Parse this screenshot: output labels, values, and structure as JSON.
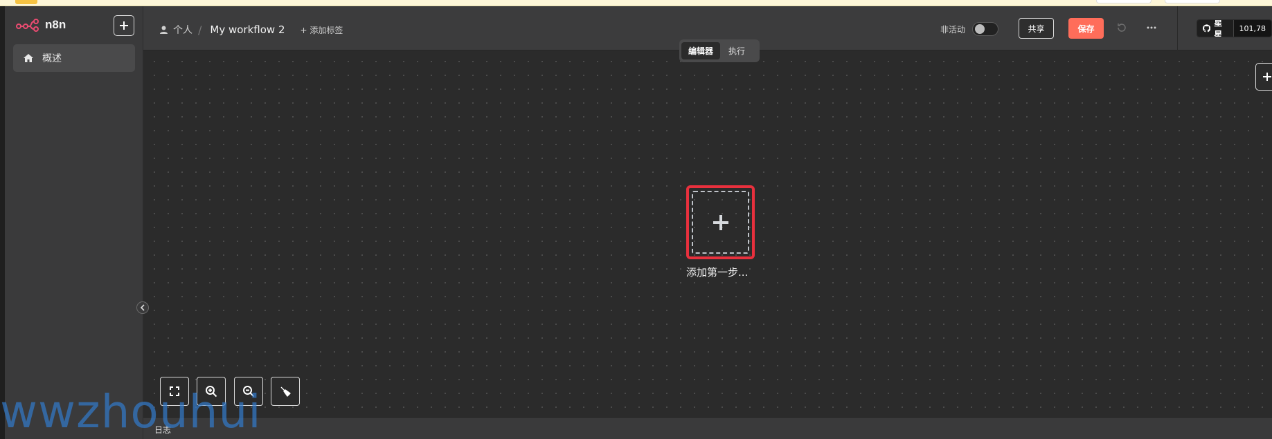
{
  "app": {
    "brand": "n8n"
  },
  "sidebar": {
    "items": [
      {
        "label": "概述",
        "icon": "home-icon"
      }
    ]
  },
  "header": {
    "breadcrumb": {
      "owner": "个人",
      "workflow_name": "My workflow 2",
      "add_tag": "+ 添加标签"
    },
    "inactive_label": "非活动",
    "share_label": "共享",
    "save_label": "保存",
    "github": {
      "label": "星星",
      "count": "101,78"
    }
  },
  "tabs": [
    {
      "label": "编辑器",
      "active": true
    },
    {
      "label": "执行",
      "active": false
    }
  ],
  "canvas": {
    "add_first_step": "添加第一步..."
  },
  "bottom": {
    "log_label": "日志"
  },
  "watermark": "wwzhouhui",
  "colors": {
    "accent": "#ff6d5a",
    "highlight": "#e8303d",
    "background": "#2b2b2b",
    "sidebar": "#3a3a3b"
  }
}
